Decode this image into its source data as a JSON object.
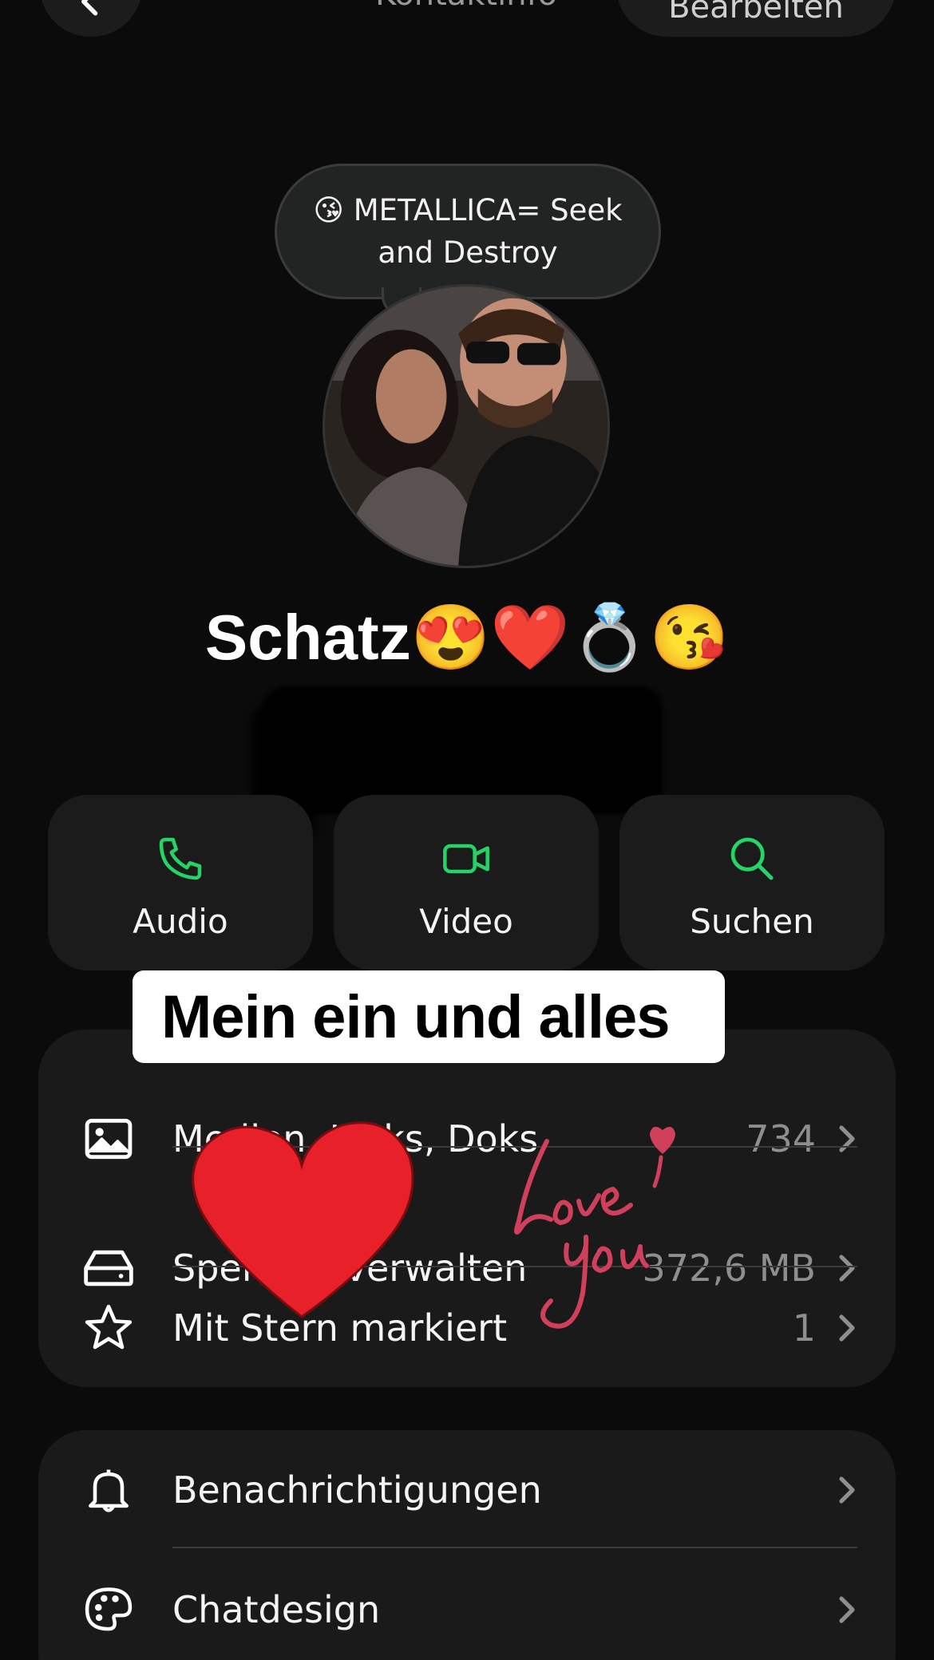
{
  "nav": {
    "title": "Kontaktinfo",
    "edit_label": "Bearbeiten"
  },
  "status": {
    "text": "😘 METALLICA= Seek and Destroy"
  },
  "contact": {
    "name": "Schatz😍❤️💍😘"
  },
  "actions": [
    {
      "label": "Audio",
      "icon": "phone-icon"
    },
    {
      "label": "Video",
      "icon": "video-icon"
    },
    {
      "label": "Suchen",
      "icon": "search-icon"
    }
  ],
  "sticker": {
    "label": "Mein ein und alles",
    "love_text": "Love you"
  },
  "list1": [
    {
      "label": "Medien, Links, Doks",
      "value": "734",
      "icon": "image-icon"
    },
    {
      "label": "Speicher verwalten",
      "value": "372,6 MB",
      "icon": "storage-icon"
    },
    {
      "label": "Mit Stern markiert",
      "value": "1",
      "icon": "star-icon"
    }
  ],
  "list2": [
    {
      "label": "Benachrichtigungen",
      "icon": "bell-icon"
    },
    {
      "label": "Chatdesign",
      "icon": "palette-icon"
    }
  ],
  "colors": {
    "accent": "#25d366",
    "background": "#0b0b0b",
    "card": "#1a1a1a",
    "heart": "#e8202a",
    "love": "#d0405a"
  }
}
